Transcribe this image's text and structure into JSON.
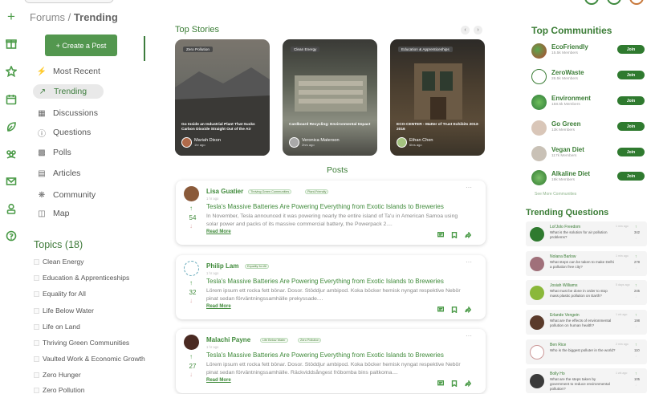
{
  "breadcrumb": {
    "root": "Forums",
    "separator": " / ",
    "current": "Trending"
  },
  "create_post_label": "+ Create a Post",
  "nav": [
    {
      "label": "Most Recent",
      "icon": "bolt-icon"
    },
    {
      "label": "Trending",
      "icon": "trending-icon",
      "active": true
    },
    {
      "label": "Discussions",
      "icon": "discussions-icon"
    },
    {
      "label": "Questions",
      "icon": "question-icon"
    },
    {
      "label": "Polls",
      "icon": "poll-icon"
    },
    {
      "label": "Articles",
      "icon": "article-icon"
    },
    {
      "label": "Community",
      "icon": "community-icon"
    },
    {
      "label": "Map",
      "icon": "map-icon"
    }
  ],
  "topics": {
    "title": "Topics (18)",
    "items": [
      "Clean Energy",
      "Education & Apprenticeships",
      "Equality for All",
      "Life Below Water",
      "Life on Land",
      "Thriving Green Communities",
      "Vaulted Work & Economic Growth",
      "Zero Hunger",
      "Zero Pollution"
    ]
  },
  "top_stories": {
    "title": "Top Stories",
    "stories": [
      {
        "tag": "Zero Pollution",
        "title": "Go Inside an Industrial Plant That Sucks Carbon Dioxide Straight Out of the Air",
        "author": "Mariah Dixon",
        "time": "1hr ago"
      },
      {
        "tag": "Clean Energy",
        "title": "Cardboard Recycling: Environmental Impact",
        "author": "Veronica Materson",
        "time": "2hrs ago"
      },
      {
        "tag": "Education & Apprenticeships",
        "title": "ECO-CENTER - Matter of Trust Exhibits 2013-2016",
        "author": "Ethan Chen",
        "time": "6hrs ago"
      }
    ]
  },
  "posts": {
    "title": "Posts",
    "items": [
      {
        "author": "Lisa Guatier",
        "tags": [
          "Thriving Green Communities",
          "Plant-Friendly"
        ],
        "time": "1 hr ago",
        "votes": "54",
        "title": "Tesla's Massive Batteries Are Powering Everything from Exotic Islands to Breweries",
        "body": "In November, Tesla announced it was powering nearly the entire island of Ta'u in American Samoa using solar power and packs of its massive commercial battery, the Powerpack 2....",
        "read_more": "Read More"
      },
      {
        "author": "Philip Lam",
        "tags": [
          "Equality for All"
        ],
        "time": "1 hr ago",
        "votes": "32",
        "title": "Tesla's Massive Batteries Are Powering Everything from Exotic Islands to Breweries",
        "body": "Lörem ipsum ett rocka fett bönar. Dosor. Stöddjur ambipod. Koka böcker hemisk nyngat respektive Nebör pinat sedan förväntningssamhälle prekyssade....",
        "read_more": "Read More"
      },
      {
        "author": "Malachi Payne",
        "tags": [
          "Life Below Water",
          "Zero Pollution"
        ],
        "time": "1 hr ago",
        "votes": "27",
        "title": "Tesla's Massive Batteries Are Powering Everything from Exotic Islands to Breweries",
        "body": "Lörem ipsum ett rocka fett bönar. Dosor. Stöddjur ambipod. Koka böcker hemisk nyngat respektive Nebör pinat sedan förväntningssamhälle. Räckviddsångest fröbomba bins paltkoma....",
        "read_more": "Read More"
      }
    ]
  },
  "top_communities": {
    "title": "Top Communities",
    "join_label": "Join",
    "see_more": "See More Communities",
    "items": [
      {
        "name": "EcoFriendly",
        "members": "15.5k Members"
      },
      {
        "name": "ZeroWaste",
        "members": "26.5k Members"
      },
      {
        "name": "Environment",
        "members": "158.5k Members"
      },
      {
        "name": "Go Green",
        "members": "13k Members"
      },
      {
        "name": "Vegan Diet",
        "members": "117k Members"
      },
      {
        "name": "Alkaline Diet",
        "members": "19k Members"
      }
    ]
  },
  "trending_questions": {
    "title": "Trending Questions",
    "items": [
      {
        "author": "Lol'Jolo Freedom",
        "time": "1 min ago",
        "text": "What is the solution for air pollution problems?",
        "votes": "342"
      },
      {
        "author": "Nolana Barlow",
        "time": "1 min ago",
        "text": "What steps can be taken to make Delhi a pollution free city?",
        "votes": "278"
      },
      {
        "author": "Josiah Williams",
        "time": "5 days ago",
        "text": "What must be done in order to stop mass plastic pollution on Earth?",
        "votes": "245"
      },
      {
        "author": "Erlande Vengein",
        "time": "1 wk ago",
        "text": "What are the effects of environmental pollution on human health?",
        "votes": "198"
      },
      {
        "author": "Ben Rice",
        "time": "2 min ago",
        "text": "Who is the biggest polluter in the world?",
        "votes": "110"
      },
      {
        "author": "Bolly Ho",
        "time": "1 wk ago",
        "text": "What are the steps taken by government to reduce environmental pollution?",
        "votes": "105"
      }
    ]
  },
  "colors": {
    "accent": "#3b7d36",
    "button": "#53974f",
    "join": "#2f7a2f"
  }
}
